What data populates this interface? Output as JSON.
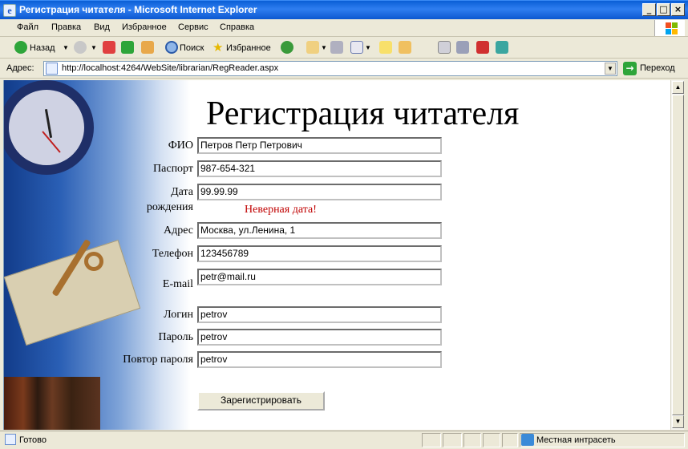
{
  "window": {
    "title": "Регистрация читателя - Microsoft Internet Explorer"
  },
  "menu": [
    "Файл",
    "Правка",
    "Вид",
    "Избранное",
    "Сервис",
    "Справка"
  ],
  "toolbar": {
    "back": "Назад",
    "search": "Поиск",
    "favorites": "Избранное"
  },
  "address": {
    "label": "Адрес:",
    "url": "http://localhost:4264/WebSite/librarian/RegReader.aspx",
    "go": "Переход"
  },
  "page": {
    "heading": "Регистрация читателя",
    "labels": {
      "fio": "ФИО",
      "passport": "Паспорт",
      "birth_1": "Дата",
      "birth_2": "рождения",
      "address": "Адрес",
      "phone": "Телефон",
      "email": "E-mail",
      "login": "Логин",
      "password": "Пароль",
      "password_repeat": "Повтор пароля"
    },
    "values": {
      "fio": "Петров Петр Петрович",
      "passport": "987-654-321",
      "birth": "99.99.99",
      "address": "Москва, ул.Ленина, 1",
      "phone": "123456789",
      "email": "petr@mail.ru",
      "login": "petrov",
      "password": "petrov",
      "password_repeat": "petrov"
    },
    "error": "Неверная дата!",
    "submit": "Зарегистрировать"
  },
  "status": {
    "text": "Готово",
    "zone": "Местная интрасеть"
  },
  "colors": {
    "titlebar": "#0a5fd6",
    "error": "#c00000"
  }
}
